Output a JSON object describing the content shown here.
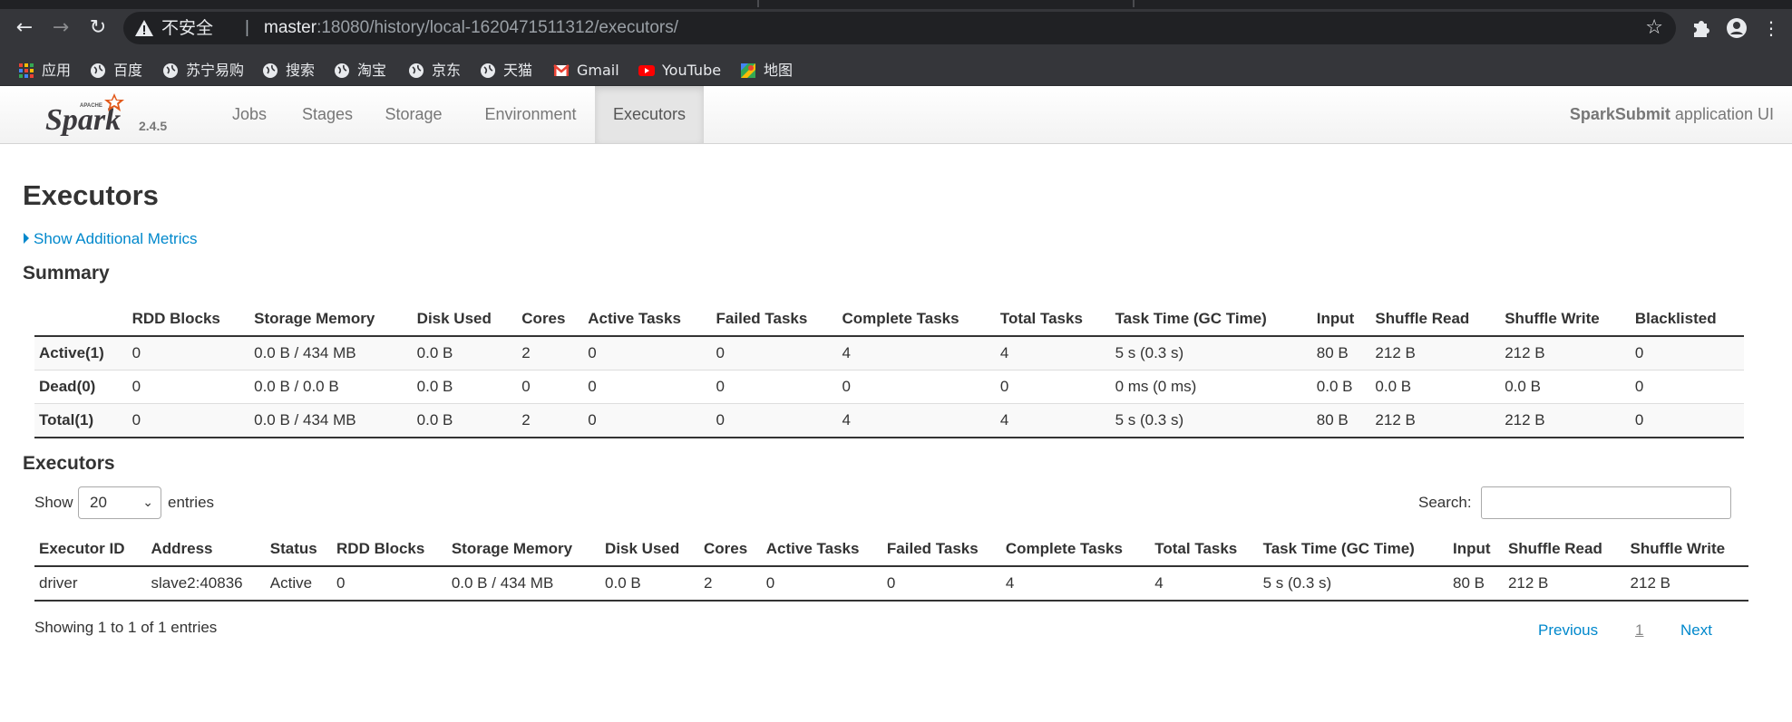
{
  "browser": {
    "insecure_label": "不安全",
    "separator": "|",
    "url_host": "master",
    "url_rest": ":18080/history/local-1620471511312/executors/",
    "bookmarks": [
      {
        "label": "应用"
      },
      {
        "label": "百度"
      },
      {
        "label": "苏宁易购"
      },
      {
        "label": "搜索"
      },
      {
        "label": "淘宝"
      },
      {
        "label": "京东"
      },
      {
        "label": "天猫"
      },
      {
        "label": "Gmail"
      },
      {
        "label": "YouTube"
      },
      {
        "label": "地图"
      }
    ]
  },
  "navbar": {
    "version": "2.4.5",
    "tabs": [
      {
        "label": "Jobs"
      },
      {
        "label": "Stages"
      },
      {
        "label": "Storage"
      },
      {
        "label": "Environment"
      },
      {
        "label": "Executors"
      }
    ],
    "active_tab": "Executors",
    "app_name": "SparkSubmit",
    "app_suffix": " application UI"
  },
  "page": {
    "title": "Executors",
    "metrics_link": "Show Additional Metrics",
    "summary_title": "Summary",
    "executors_title": "Executors"
  },
  "summary": {
    "headers": [
      "",
      "RDD Blocks",
      "Storage Memory",
      "Disk Used",
      "Cores",
      "Active Tasks",
      "Failed Tasks",
      "Complete Tasks",
      "Total Tasks",
      "Task Time (GC Time)",
      "Input",
      "Shuffle Read",
      "Shuffle Write",
      "Blacklisted"
    ],
    "rows": [
      [
        "Active(1)",
        "0",
        "0.0 B / 434 MB",
        "0.0 B",
        "2",
        "0",
        "0",
        "4",
        "4",
        "5 s (0.3 s)",
        "80 B",
        "212 B",
        "212 B",
        "0"
      ],
      [
        "Dead(0)",
        "0",
        "0.0 B / 0.0 B",
        "0.0 B",
        "0",
        "0",
        "0",
        "0",
        "0",
        "0 ms (0 ms)",
        "0.0 B",
        "0.0 B",
        "0.0 B",
        "0"
      ],
      [
        "Total(1)",
        "0",
        "0.0 B / 434 MB",
        "0.0 B",
        "2",
        "0",
        "0",
        "4",
        "4",
        "5 s (0.3 s)",
        "80 B",
        "212 B",
        "212 B",
        "0"
      ]
    ]
  },
  "executors": {
    "show_label": "Show",
    "entries_label": "entries",
    "page_size": "20",
    "search_label": "Search:",
    "search_value": "",
    "headers": [
      "Executor ID",
      "Address",
      "Status",
      "RDD Blocks",
      "Storage Memory",
      "Disk Used",
      "Cores",
      "Active Tasks",
      "Failed Tasks",
      "Complete Tasks",
      "Total Tasks",
      "Task Time (GC Time)",
      "Input",
      "Shuffle Read",
      "Shuffle Write"
    ],
    "rows": [
      [
        "driver",
        "slave2:40836",
        "Active",
        "0",
        "0.0 B / 434 MB",
        "0.0 B",
        "2",
        "0",
        "0",
        "4",
        "4",
        "5 s (0.3 s)",
        "80 B",
        "212 B",
        "212 B"
      ]
    ],
    "showing": "Showing 1 to 1 of 1 entries",
    "pagination": {
      "previous": "Previous",
      "current": "1",
      "next": "Next"
    }
  }
}
